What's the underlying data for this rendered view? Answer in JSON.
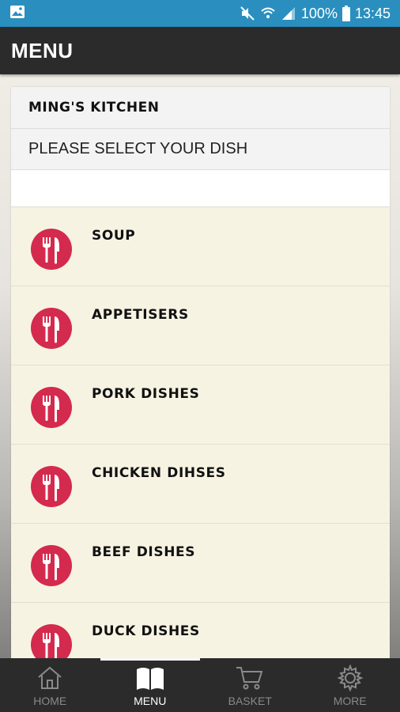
{
  "status": {
    "battery": "100%",
    "time": "13:45"
  },
  "app_bar": {
    "title": "MENU"
  },
  "panel": {
    "restaurant": "MING'S KITCHEN",
    "subtitle": "PLEASE SELECT YOUR DISH",
    "items": [
      {
        "label": "SOUP"
      },
      {
        "label": "APPETISERS"
      },
      {
        "label": "PORK DISHES"
      },
      {
        "label": "CHICKEN DIHSES"
      },
      {
        "label": "BEEF DISHES"
      },
      {
        "label": "DUCK DISHES"
      }
    ]
  },
  "bottom_nav": {
    "items": [
      {
        "label": "HOME",
        "icon": "home-icon"
      },
      {
        "label": "MENU",
        "icon": "book-icon",
        "active": true
      },
      {
        "label": "BASKET",
        "icon": "cart-icon"
      },
      {
        "label": "MORE",
        "icon": "gear-icon"
      }
    ]
  },
  "colors": {
    "status_bar": "#2a8fbf",
    "app_bar": "#2b2b2b",
    "panel_bg": "#f7f3e3",
    "icon_red": "#d42a4e"
  }
}
